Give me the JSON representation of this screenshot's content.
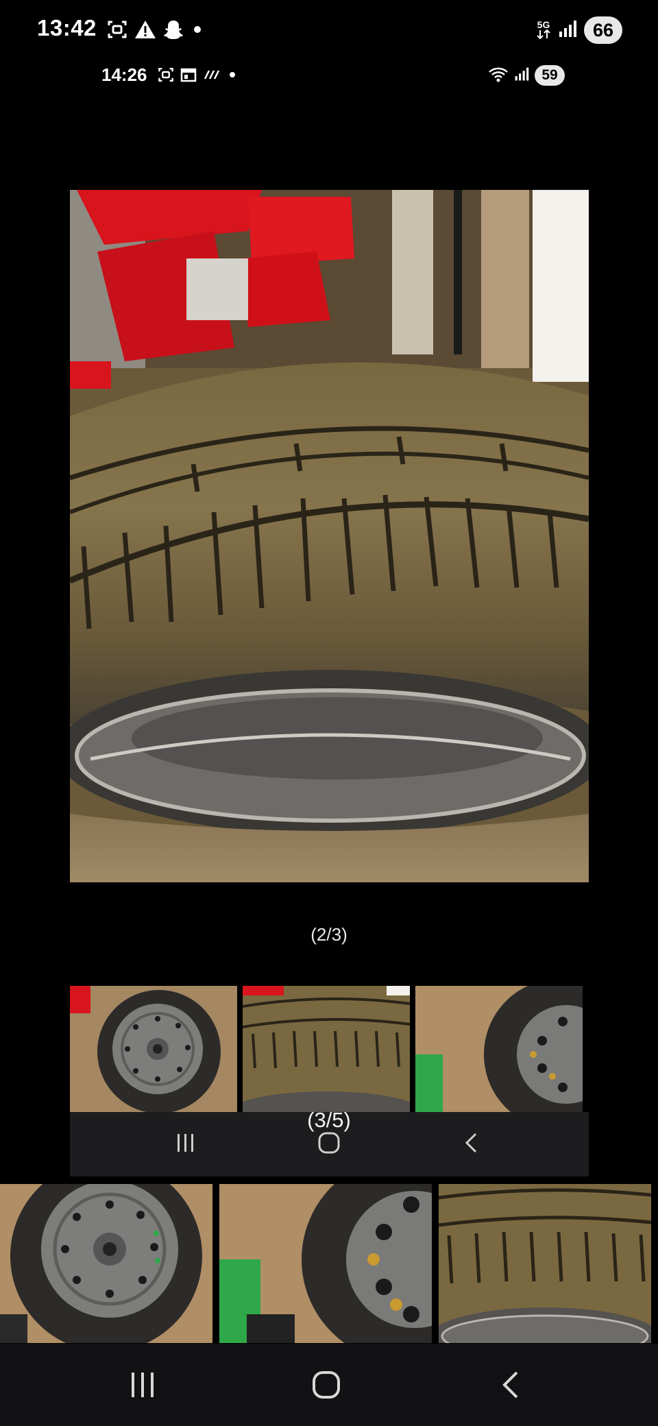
{
  "status_bar_outer": {
    "time": "13:42",
    "network": "5G",
    "battery": "66"
  },
  "status_bar_inner": {
    "time": "14:26",
    "battery": "59"
  },
  "viewer": {
    "main_photo_icon": "tire-tread-photo",
    "counter": "(2/3)",
    "thumbnails": [
      {
        "icon": "steel-wheel-photo"
      },
      {
        "icon": "tire-tread-photo"
      },
      {
        "icon": "tire-sidewall-photo"
      }
    ]
  },
  "inner_gallery": {
    "counter": "(3/5)"
  },
  "outer_gallery": {
    "thumbnails": [
      {
        "icon": "steel-wheel-photo"
      },
      {
        "icon": "tire-sidewall-photo"
      },
      {
        "icon": "tire-tread-photo"
      }
    ]
  },
  "navigation": {
    "buttons": [
      "recent-apps-icon",
      "home-icon",
      "back-icon"
    ]
  },
  "colors": {
    "background": "#000000",
    "nav_inner": "#1d1d1f",
    "nav_outer": "#121214",
    "crate_red": "#d8141c"
  }
}
